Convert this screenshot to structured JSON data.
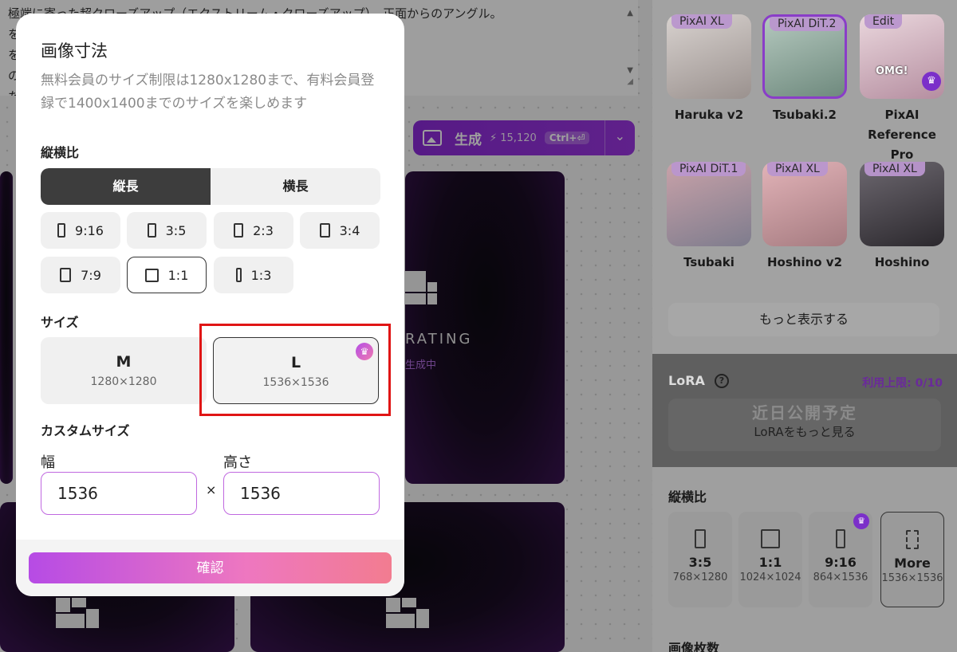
{
  "background": {
    "prompt_lines": [
      "極端に寄った超クローズアップ（エクストリーム・クローズアップ）。正面からのアングル。",
      "を写",
      "を写",
      "の外                                                                                  ）の構図。",
      "た。"
    ],
    "generate": {
      "label": "生成",
      "cost": "15,120",
      "shortcut": "Ctrl+⏎"
    },
    "rating_text": "RATING",
    "rating_sub": "生成中"
  },
  "right_panel": {
    "models": [
      {
        "tag": "PixAI XL",
        "name": "Haruka v2",
        "color": "#b9b2ae"
      },
      {
        "tag": "PixAI DiT.2",
        "name": "Tsubaki.2",
        "color": "#8ea59c"
      },
      {
        "tag": "Edit",
        "name": "PixAI Reference Pro",
        "color": "#c9a8b6"
      },
      {
        "tag": "PixAI DiT.1",
        "name": "Tsubaki",
        "color": "#b08a92"
      },
      {
        "tag": "PixAI XL",
        "name": "Hoshino v2",
        "color": "#c79aa0"
      },
      {
        "tag": "PixAI XL",
        "name": "Hoshino",
        "color": "#555058"
      }
    ],
    "omg": "OMG!",
    "show_more": "もっと表示する",
    "lora": {
      "title": "LoRA",
      "limit": "利用上限: 0/10",
      "coming_soon": "近日公開予定",
      "see_more": "LoRAをもっと見る"
    },
    "aspect_title": "縦横比",
    "aspect_cards": [
      {
        "name": "3:5",
        "dims": "768×1280"
      },
      {
        "name": "1:1",
        "dims": "1024×1024"
      },
      {
        "name": "9:16",
        "dims": "864×1536"
      },
      {
        "name": "More",
        "dims": "1536×1536"
      }
    ],
    "count_title": "画像枚数"
  },
  "modal": {
    "title": "画像寸法",
    "description": "無料会員のサイズ制限は1280x1280まで、有料会員登録で1400x1400までのサイズを楽しめます",
    "aspect_label": "縦横比",
    "orientation": {
      "portrait": "縦長",
      "landscape": "横長",
      "selected": "縦長"
    },
    "ratios": [
      "9:16",
      "3:5",
      "2:3",
      "3:4",
      "7:9",
      "1:1",
      "1:3"
    ],
    "selected_ratio": "1:1",
    "size_label": "サイズ",
    "sizes": [
      {
        "name": "M",
        "dims": "1280×1280"
      },
      {
        "name": "L",
        "dims": "1536×1536"
      }
    ],
    "selected_size": "L",
    "custom_label": "カスタムサイズ",
    "width_label": "幅",
    "height_label": "高さ",
    "width_value": "1536",
    "height_value": "1536",
    "times": "×",
    "confirm": "確認"
  },
  "colors": {
    "accent": "#9a36e0",
    "highlight": "#e01515"
  }
}
